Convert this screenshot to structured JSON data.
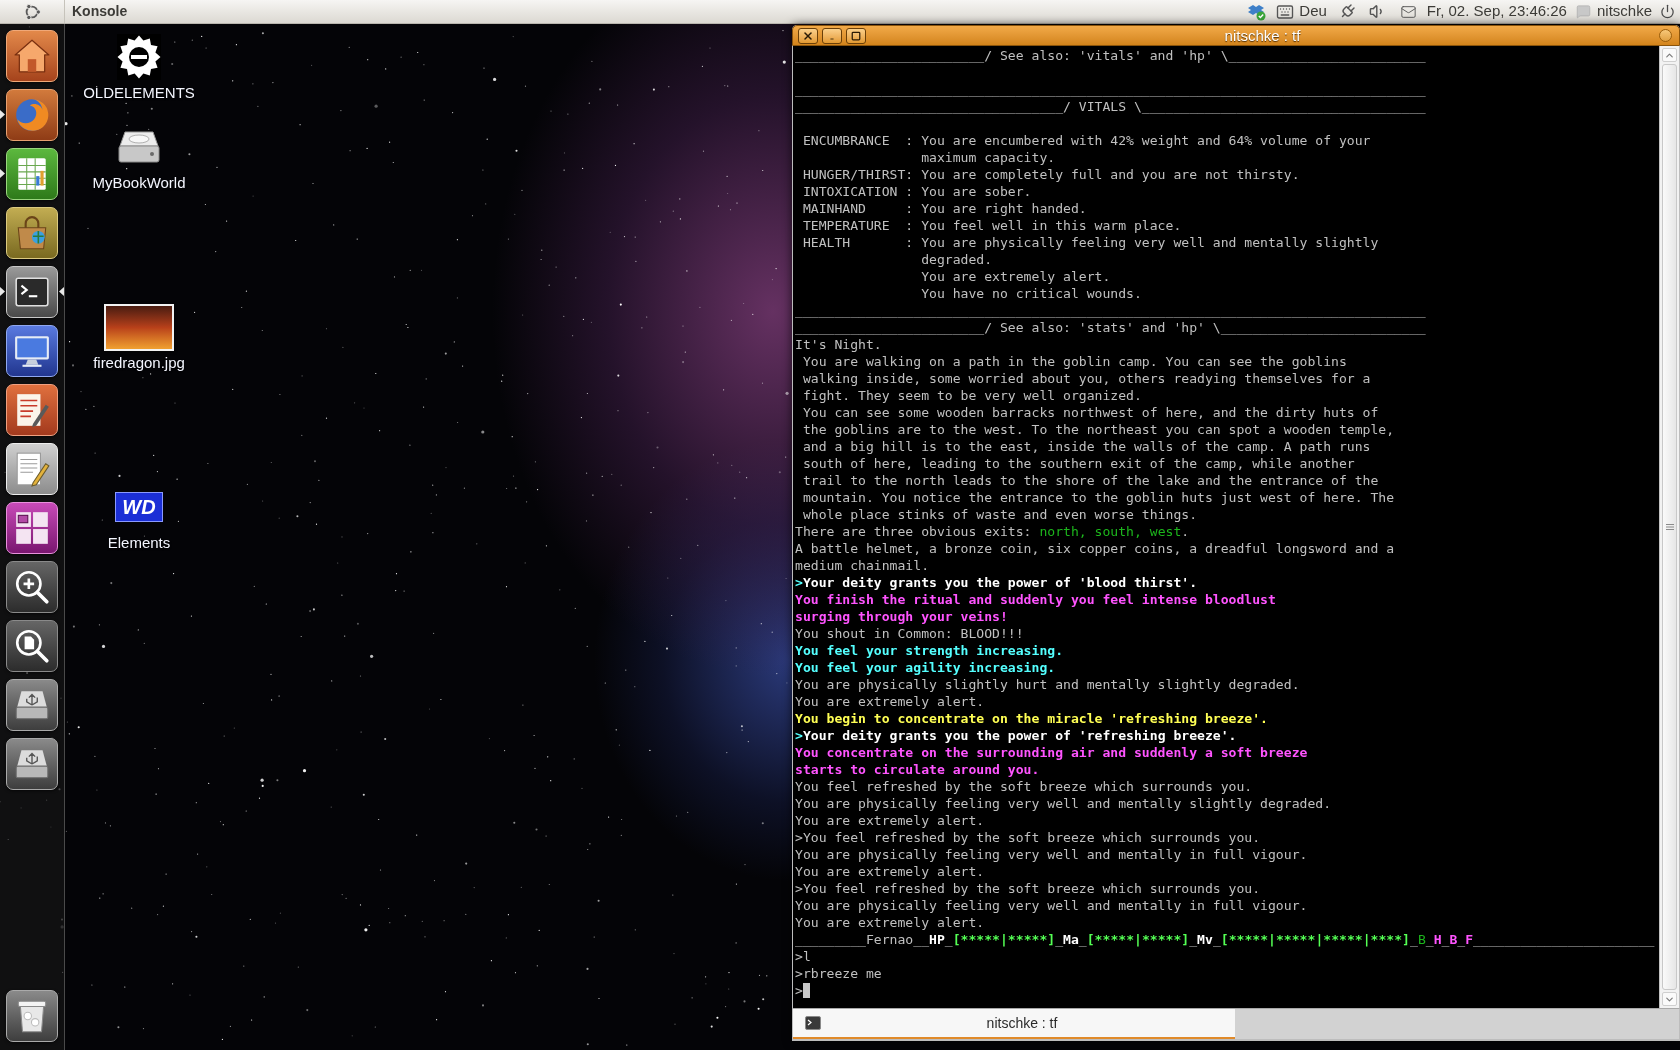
{
  "top_panel": {
    "app_name": "Konsole",
    "keyboard_layout": "Deu",
    "clock": "Fr, 02. Sep, 23:46:26",
    "user": "nitschke"
  },
  "launcher": {
    "items": [
      {
        "kind": "home",
        "running": false,
        "active": false
      },
      {
        "kind": "browser",
        "running": true,
        "active": false
      },
      {
        "kind": "spreadsheet",
        "running": true,
        "active": false
      },
      {
        "kind": "store",
        "running": false,
        "active": false
      },
      {
        "kind": "terminal",
        "running": true,
        "active": true
      },
      {
        "kind": "monitor",
        "running": false,
        "active": false
      },
      {
        "kind": "form",
        "running": false,
        "active": false
      },
      {
        "kind": "notes",
        "running": false,
        "active": false
      },
      {
        "kind": "workspaces",
        "running": false,
        "active": false
      },
      {
        "kind": "zoomin",
        "running": false,
        "active": false
      },
      {
        "kind": "viewer",
        "running": false,
        "active": false
      },
      {
        "kind": "drive",
        "running": false,
        "active": false
      },
      {
        "kind": "drive",
        "running": false,
        "active": false
      },
      {
        "kind": "trash",
        "running": false,
        "active": false
      }
    ]
  },
  "desktop_icons": [
    {
      "kind": "emblem",
      "label": "OLDELEMENTS"
    },
    {
      "kind": "disk",
      "label": "MyBookWorld"
    },
    {
      "kind": "photo",
      "label": "firedragon.jpg"
    },
    {
      "kind": "logo",
      "label": "Elements",
      "logo_text": "WD"
    }
  ],
  "terminal_window": {
    "title": "nitschke : tf",
    "output_lines": [
      {
        "kind": "text",
        "segments": [
          {
            "text": "________________________/ See also: 'vitals' and 'hp' \\_________________________",
            "bold": false
          }
        ]
      },
      {
        "kind": "blank"
      },
      {
        "kind": "text",
        "segments": [
          {
            "text": "________________________________________________________________________________",
            "bold": false
          }
        ]
      },
      {
        "kind": "text",
        "segments": [
          {
            "text": "__________________________________/ VITALS \\____________________________________",
            "bold": false
          }
        ]
      },
      {
        "kind": "blank"
      },
      {
        "kind": "text",
        "segments": [
          {
            "text": " ENCUMBRANCE  : You are encumbered with 42% weight and 64% volume of your",
            "bold": false
          }
        ]
      },
      {
        "kind": "text",
        "segments": [
          {
            "text": "                maximum capacity.",
            "bold": false
          }
        ]
      },
      {
        "kind": "text",
        "segments": [
          {
            "text": " HUNGER/THIRST: You are completely full and you are not thirsty.",
            "bold": false
          }
        ]
      },
      {
        "kind": "text",
        "segments": [
          {
            "text": " INTOXICATION : You are sober.",
            "bold": false
          }
        ]
      },
      {
        "kind": "text",
        "segments": [
          {
            "text": " MAINHAND     : You are right handed.",
            "bold": false
          }
        ]
      },
      {
        "kind": "text",
        "segments": [
          {
            "text": " TEMPERATURE  : You feel well in this warm place.",
            "bold": false
          }
        ]
      },
      {
        "kind": "text",
        "segments": [
          {
            "text": " HEALTH       : You are physically feeling very well and mentally slightly",
            "bold": false
          }
        ]
      },
      {
        "kind": "text",
        "segments": [
          {
            "text": "                degraded.",
            "bold": false
          }
        ]
      },
      {
        "kind": "text",
        "segments": [
          {
            "text": "                You are extremely alert.",
            "bold": false
          }
        ]
      },
      {
        "kind": "text",
        "segments": [
          {
            "text": "                You have no critical wounds.",
            "bold": false
          }
        ]
      },
      {
        "kind": "text",
        "segments": [
          {
            "text": "________________________________________________________________________________",
            "bold": false
          }
        ]
      },
      {
        "kind": "text",
        "segments": [
          {
            "text": "________________________/ See also: 'stats' and 'hp' \\__________________________",
            "bold": false
          }
        ]
      },
      {
        "kind": "text",
        "segments": [
          {
            "text": "It's Night.",
            "bold": false
          }
        ]
      },
      {
        "kind": "text",
        "segments": [
          {
            "text": " You are walking on a path in the goblin camp. You can see the goblins",
            "bold": false
          }
        ]
      },
      {
        "kind": "text",
        "segments": [
          {
            "text": " walking inside, some worried about you, others readying themselves for a",
            "bold": false
          }
        ]
      },
      {
        "kind": "text",
        "segments": [
          {
            "text": " fight. They seem to be very well organized.",
            "bold": false
          }
        ]
      },
      {
        "kind": "text",
        "segments": [
          {
            "text": " You can see some wooden barracks northwest of here, and the dirty huts of",
            "bold": false
          }
        ]
      },
      {
        "kind": "text",
        "segments": [
          {
            "text": " the goblins are to the west. To the northeast you can spot a wooden temple,",
            "bold": false
          }
        ]
      },
      {
        "kind": "text",
        "segments": [
          {
            "text": " and a big hill is to the east, inside the walls of the camp. A path runs",
            "bold": false
          }
        ]
      },
      {
        "kind": "text",
        "segments": [
          {
            "text": " south of here, leading to the southern exit of the camp, while another",
            "bold": false
          }
        ]
      },
      {
        "kind": "text",
        "segments": [
          {
            "text": " trail to the north leads to the shore of the lake and the entrance of the",
            "bold": false
          }
        ]
      },
      {
        "kind": "text",
        "segments": [
          {
            "text": " mountain. You notice the entrance to the goblin huts just west of here. The",
            "bold": false
          }
        ]
      },
      {
        "kind": "text",
        "segments": [
          {
            "text": " whole place stinks of waste and even worse things.",
            "bold": false
          }
        ]
      },
      {
        "kind": "text",
        "segments": [
          {
            "text": "There are three obvious exits: ",
            "bold": false
          },
          {
            "text": "north, south, west",
            "color": "#1cb51c",
            "bold": false
          },
          {
            "text": ".",
            "bold": false
          }
        ]
      },
      {
        "kind": "text",
        "segments": [
          {
            "text": "A battle helmet, a bronze coin, six copper coins, a dreadful longsword and a",
            "bold": false
          }
        ]
      },
      {
        "kind": "text",
        "segments": [
          {
            "text": "medium chainmail.",
            "bold": false
          }
        ]
      },
      {
        "kind": "text",
        "segments": [
          {
            "text": ">",
            "color": "#54ffff",
            "bold": true
          },
          {
            "text": "Your deity grants you the power of 'blood thirst'.",
            "color": "#ffffff",
            "bold": true
          }
        ]
      },
      {
        "kind": "text",
        "segments": [
          {
            "text": "You finish the ritual and suddenly you feel intense bloodlust",
            "color": "#ff54ff",
            "bold": true
          }
        ]
      },
      {
        "kind": "text",
        "segments": [
          {
            "text": "surging through your veins!",
            "color": "#ff54ff",
            "bold": true
          }
        ]
      },
      {
        "kind": "text",
        "segments": [
          {
            "text": "You shout in Common: BLOOD!!!",
            "bold": false
          }
        ]
      },
      {
        "kind": "text",
        "segments": [
          {
            "text": "You feel your strength increasing.",
            "color": "#54ffff",
            "bold": true
          }
        ]
      },
      {
        "kind": "text",
        "segments": [
          {
            "text": "You feel your agility increasing.",
            "color": "#54ffff",
            "bold": true
          }
        ]
      },
      {
        "kind": "text",
        "segments": [
          {
            "text": "You are physically slightly hurt and mentally slightly degraded.",
            "bold": false
          }
        ]
      },
      {
        "kind": "text",
        "segments": [
          {
            "text": "You are extremely alert.",
            "bold": false
          }
        ]
      },
      {
        "kind": "text",
        "segments": [
          {
            "text": "You begin to concentrate on the miracle 'refreshing breeze'.",
            "color": "#ffff54",
            "bold": true
          }
        ]
      },
      {
        "kind": "text",
        "segments": [
          {
            "text": ">",
            "color": "#54ffff",
            "bold": true
          },
          {
            "text": "Your deity grants you the power of 'refreshing breeze'.",
            "color": "#ffffff",
            "bold": true
          }
        ]
      },
      {
        "kind": "text",
        "segments": [
          {
            "text": "You concentrate on the surrounding air and suddenly a soft breeze",
            "color": "#ff54ff",
            "bold": true
          }
        ]
      },
      {
        "kind": "text",
        "segments": [
          {
            "text": "starts to circulate around you.",
            "color": "#ff54ff",
            "bold": true
          }
        ]
      },
      {
        "kind": "text",
        "segments": [
          {
            "text": "You feel refreshed by the soft breeze which surrounds you.",
            "bold": false
          }
        ]
      },
      {
        "kind": "text",
        "segments": [
          {
            "text": "You are physically feeling very well and mentally slightly degraded.",
            "bold": false
          }
        ]
      },
      {
        "kind": "text",
        "segments": [
          {
            "text": "You are extremely alert.",
            "bold": false
          }
        ]
      },
      {
        "kind": "text",
        "segments": [
          {
            "text": ">You feel refreshed by the soft breeze which surrounds you.",
            "bold": false
          }
        ]
      },
      {
        "kind": "text",
        "segments": [
          {
            "text": "You are physically feeling very well and mentally in full vigour.",
            "bold": false
          }
        ]
      },
      {
        "kind": "text",
        "segments": [
          {
            "text": "You are extremely alert.",
            "bold": false
          }
        ]
      },
      {
        "kind": "text",
        "segments": [
          {
            "text": ">You feel refreshed by the soft breeze which surrounds you.",
            "bold": false
          }
        ]
      },
      {
        "kind": "text",
        "segments": [
          {
            "text": "You are physically feeling very well and mentally in full vigour.",
            "bold": false
          }
        ]
      },
      {
        "kind": "text",
        "segments": [
          {
            "text": "You are extremely alert.",
            "bold": false
          }
        ]
      }
    ],
    "status_line": [
      {
        "text": "_________Fernao__",
        "bold": false
      },
      {
        "text": "HP",
        "color": "#ffffff",
        "bold": true
      },
      {
        "text": "_",
        "bold": false
      },
      {
        "text": "[*****|*****]",
        "color": "#54ff54",
        "bold": true
      },
      {
        "text": "_",
        "bold": false
      },
      {
        "text": "Ma",
        "color": "#ffffff",
        "bold": true
      },
      {
        "text": "_",
        "bold": false
      },
      {
        "text": "[*****|*****]",
        "color": "#54ff54",
        "bold": true
      },
      {
        "text": "_",
        "bold": false
      },
      {
        "text": "Mv",
        "color": "#ffffff",
        "bold": true
      },
      {
        "text": "_",
        "bold": false
      },
      {
        "text": "[*****|*****|*****|****]",
        "color": "#54ff54",
        "bold": true
      },
      {
        "text": "_",
        "bold": false
      },
      {
        "text": "B",
        "color": "#1cb51c",
        "bold": false
      },
      {
        "text": "_",
        "bold": false
      },
      {
        "text": "H",
        "color": "#ff54ff",
        "bold": true
      },
      {
        "text": "_",
        "bold": false
      },
      {
        "text": "B",
        "color": "#ff54ff",
        "bold": true
      },
      {
        "text": "_",
        "bold": false
      },
      {
        "text": "F",
        "color": "#ff54ff",
        "bold": true
      },
      {
        "text": "_______________________",
        "bold": false
      }
    ],
    "input_lines": [
      {
        "text": ">l",
        "cursor": false
      },
      {
        "text": ">rbreeze me",
        "cursor": false
      },
      {
        "text": ">",
        "cursor": true
      }
    ],
    "tabs": [
      {
        "label": "nitschke : tf",
        "selected": true
      }
    ]
  }
}
